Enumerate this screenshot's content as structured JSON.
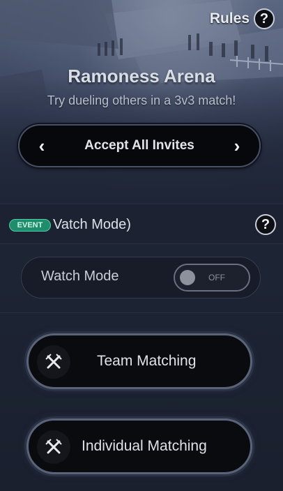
{
  "header": {
    "rules_label": "Rules",
    "rules_help_glyph": "?",
    "arena_title": "Ramoness Arena",
    "arena_subtitle": "Try dueling others in a 3v3 match!"
  },
  "invite_selector": {
    "label": "Accept All Invites",
    "prev_glyph": "‹",
    "next_glyph": "›"
  },
  "event_section": {
    "badge": "EVENT",
    "title": "Vatch Mode)",
    "help_glyph": "?"
  },
  "watch_mode": {
    "label": "Watch Mode",
    "toggle_state": "OFF"
  },
  "matching": {
    "team_label": "Team Matching",
    "individual_label": "Individual Matching",
    "icon": "crossed-swords-icon"
  },
  "colors": {
    "event_badge": "#1f8c6b",
    "button_bg": "#0a0b0f",
    "button_border": "#5a6479"
  }
}
